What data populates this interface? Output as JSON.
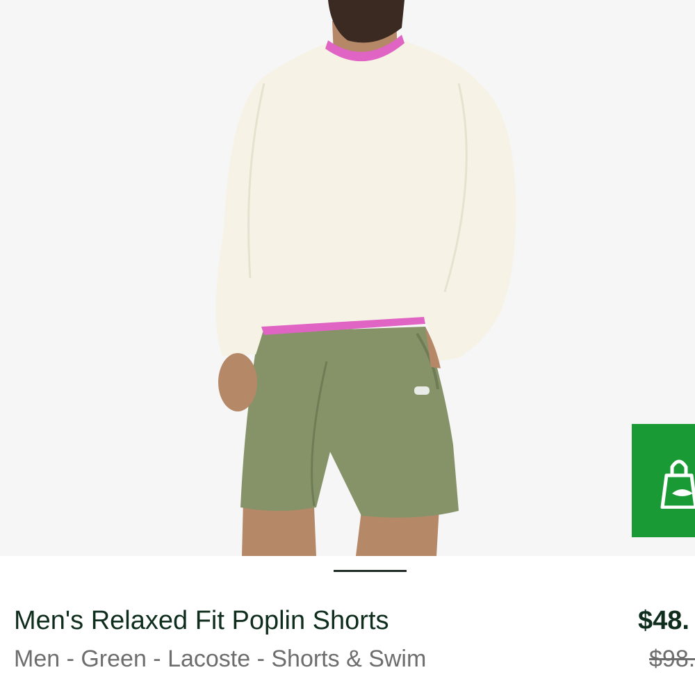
{
  "product": {
    "title": "Men's Relaxed Fit Poplin Shorts",
    "subtitle": "Men - Green - Lacoste - Shorts & Swim",
    "price": "$48.",
    "original_price": "$98."
  },
  "image": {
    "colors": {
      "background": "#f6f6f7",
      "sweatshirt": "#f6f3e6",
      "collar": "#e064c4",
      "shorts": "#869369",
      "skin": "#b58868"
    }
  },
  "actions": {
    "add_to_bag_icon": "shopping-bag-icon",
    "accent": "#1a9a34"
  }
}
